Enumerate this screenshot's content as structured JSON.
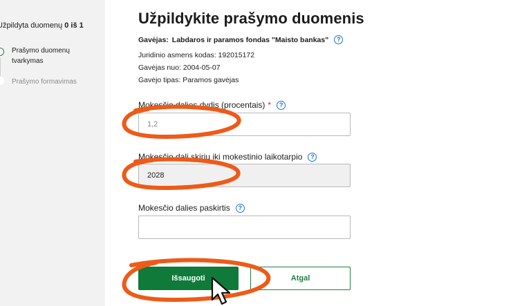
{
  "sidebar": {
    "progress_prefix": "Užpildyta duomenų",
    "progress_count": "0 iš 1",
    "steps": [
      {
        "label": "Prašymo duomenų tvarkymas"
      },
      {
        "label": "Prašymo formavimas"
      }
    ]
  },
  "main": {
    "title": "Užpildykite prašymo duomenis",
    "recipient_label": "Gavėjas:",
    "recipient_name": "Labdaros ir paramos fondas \"Maisto bankas\"",
    "info": {
      "code": "Juridinio asmens kodas: 192015172",
      "since": "Gavėjas nuo: 2004-05-07",
      "type": "Gavėjo tipas: Paramos gavėjas"
    },
    "fields": {
      "percent_label": "Mokesčio dalies dydis (procentais)",
      "percent_required": "*",
      "percent_value": "1,2",
      "period_label": "Mokesčio dalį skiriu iki mokestinio laikotarpio",
      "period_value": "2028",
      "purpose_label": "Mokesčio dalies paskirtis",
      "purpose_value": ""
    },
    "buttons": {
      "save": "Išsaugoti",
      "back": "Atgal"
    }
  },
  "icons": {
    "help": "question-circle-icon",
    "cursor": "mouse-pointer-icon"
  },
  "colors": {
    "accent_green": "#0f7a3a",
    "help_blue": "#1f6fd1",
    "annotation_orange": "#ee5a17",
    "required_red": "#d2232a"
  }
}
